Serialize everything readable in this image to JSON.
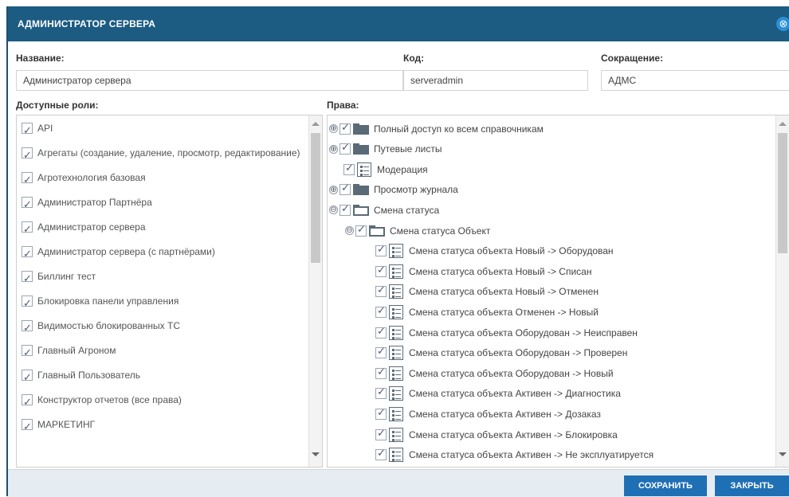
{
  "window": {
    "title": "АДМИНИСТРАТОР СЕРВЕРА",
    "close_icon": "⊗"
  },
  "form": {
    "name_label": "Название:",
    "name_value": "Администратор сервера",
    "code_label": "Код:",
    "code_value": "serveradmin",
    "short_label": "Сокращение:",
    "short_value": "АДМС"
  },
  "roles": {
    "label": "Доступные роли:",
    "items": [
      "API",
      "Агрегаты (создание, удаление, просмотр, редактирование)",
      "Агротехнология базовая",
      "Администратор Партнёра",
      "Администратор сервера",
      "Администратор сервера (с партнёрами)",
      "Биллинг тест",
      "Блокировка панели управления",
      "Видимостью блокированных ТС",
      "Главный Агроном",
      "Главный Пользователь",
      "Конструктор отчетов (все права)",
      "МАРКЕТИНГ"
    ]
  },
  "rights": {
    "label": "Права:",
    "items": [
      {
        "text": "Полный доступ ко всем справочникам",
        "expander": "⊕",
        "icon": "folder"
      },
      {
        "text": "Путевые листы",
        "expander": "⊕",
        "icon": "folder"
      },
      {
        "text": "Модерация",
        "expander": "",
        "icon": "doc"
      },
      {
        "text": "Просмотр журнала",
        "expander": "⊕",
        "icon": "folder"
      },
      {
        "text": "Смена статуса",
        "expander": "⊖",
        "icon": "folder-open"
      },
      {
        "text": "Смена статуса Объект",
        "expander": "⊖",
        "icon": "folder-open"
      },
      {
        "text": "Смена статуса объекта Новый -> Оборудован",
        "expander": "",
        "icon": "doc"
      },
      {
        "text": "Смена статуса объекта Новый -> Списан",
        "expander": "",
        "icon": "doc"
      },
      {
        "text": "Смена статуса объекта Новый -> Отменен",
        "expander": "",
        "icon": "doc"
      },
      {
        "text": "Смена статуса объекта Отменен -> Новый",
        "expander": "",
        "icon": "doc"
      },
      {
        "text": "Смена статуса объекта Оборудован -> Неисправен",
        "expander": "",
        "icon": "doc"
      },
      {
        "text": "Смена статуса объекта Оборудован -> Проверен",
        "expander": "",
        "icon": "doc"
      },
      {
        "text": "Смена статуса объекта Оборудован -> Новый",
        "expander": "",
        "icon": "doc"
      },
      {
        "text": "Смена статуса объекта Активен -> Диагностика",
        "expander": "",
        "icon": "doc"
      },
      {
        "text": "Смена статуса объекта Активен -> Дозаказ",
        "expander": "",
        "icon": "doc"
      },
      {
        "text": "Смена статуса объекта Активен -> Блокировка",
        "expander": "",
        "icon": "doc"
      },
      {
        "text": "Смена статуса объекта Активен -> Не эксплуатируется",
        "expander": "",
        "icon": "doc"
      }
    ]
  },
  "footer": {
    "save_label": "СОХРАНИТЬ",
    "close_label": "ЗАКРЫТЬ"
  },
  "colors": {
    "titlebar": "#1c5b82",
    "button": "#1f6fb4",
    "footer": "#e6edf2"
  }
}
